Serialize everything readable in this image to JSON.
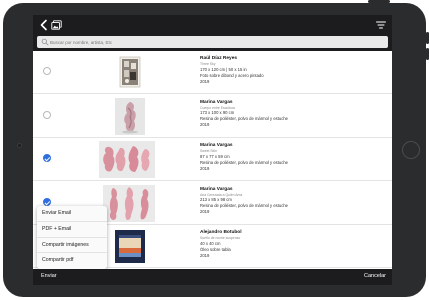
{
  "search": {
    "placeholder": "Buscar por nombre, artista, Etc"
  },
  "artworks": [
    {
      "artist": "Raúl Díaz Reyes",
      "title": "Three Sky",
      "dimensions": "170 x 120 cm | 50 x 15 in",
      "medium": "Foto sobre dibond y acero pintado",
      "year": "2019",
      "selected": false
    },
    {
      "artist": "Marina Vargas",
      "title": "Cuerpo entre Escultura",
      "dimensions": "173 x 100 x 90 cm",
      "medium": "Resina de poliéster, polvo de mármol y estuche",
      "year": "2019",
      "selected": false
    },
    {
      "artist": "Marina Vargas",
      "title": "Sweet Skin",
      "dimensions": "87 x 77 x 59 cm",
      "medium": "Resina de poliéster, polvo de mármol y estuche",
      "year": "2019",
      "selected": true
    },
    {
      "artist": "Marina Vargas",
      "title": "Ana Cerezada a Quién Ama",
      "dimensions": "213 x 85 x 98 cm",
      "medium": "Resina de poliéster, polvo de mármol y estuche",
      "year": "2019",
      "selected": true
    },
    {
      "artist": "Alejandro Botubol",
      "title": "Sueño de noche suspenso",
      "dimensions": "40 x 40 cm",
      "medium": "Óleo sobre tabla",
      "year": "2019",
      "selected": false
    }
  ],
  "share_menu": {
    "items": [
      "Enviar Email",
      "PDF + Email",
      "Compartir imágenes",
      "Compartir pdf"
    ]
  },
  "footer": {
    "send_label": "Enviar",
    "cancel_label": "Cancelar"
  },
  "colors": {
    "accent": "#2f6ee0",
    "toolbar": "#1c1c1e",
    "bezel": "#2b2c2e"
  }
}
